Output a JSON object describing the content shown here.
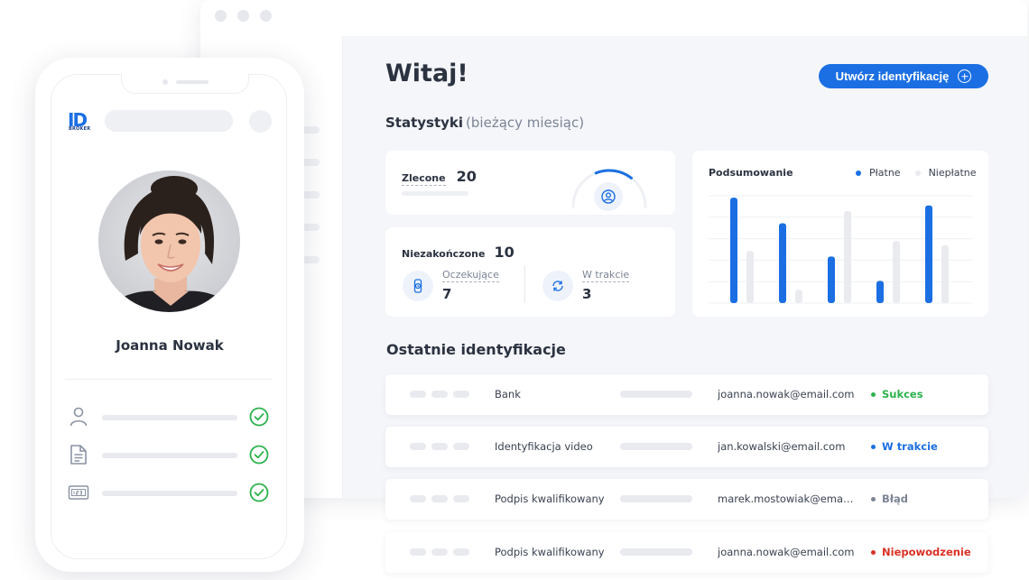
{
  "header": {
    "greeting": "Witaj!",
    "create_button_label": "Utwórz identyfikację"
  },
  "stats": {
    "title": "Statystyki",
    "subtitle": "(bieżący miesiąc)",
    "ordered": {
      "label": "Zlecone",
      "value": "20"
    },
    "unfinished": {
      "label": "Niezakończone",
      "value": "10"
    },
    "pending": {
      "label": "Oczekujące",
      "value": "7"
    },
    "in_progress": {
      "label": "W trakcie",
      "value": "3"
    },
    "gauge_fraction": 0.33
  },
  "chart_data": {
    "type": "bar",
    "title": "Podsumowanie",
    "legend_position": "top-right",
    "grid": true,
    "ylim": [
      0,
      1
    ],
    "categories": [
      "",
      "",
      "",
      "",
      ""
    ],
    "series": [
      {
        "name": "Płatne",
        "color": "#1b6fe3",
        "values": [
          0.95,
          0.72,
          0.42,
          0.2,
          0.88
        ]
      },
      {
        "name": "Niepłatne",
        "color": "#e9ebef",
        "values": [
          0.47,
          0.12,
          0.83,
          0.56,
          0.52
        ]
      }
    ]
  },
  "recent": {
    "title": "Ostatnie identyfikacje",
    "rows": [
      {
        "type": "Bank",
        "email": "joanna.nowak@email.com",
        "status": "Sukces",
        "status_color": "#2bb24c"
      },
      {
        "type": "Identyfikacja video",
        "email": "jan.kowalski@email.com",
        "status": "W trakcie",
        "status_color": "#1b6fe3"
      },
      {
        "type": "Podpis kwalifikowany",
        "email": "marek.mostowiak@email.com",
        "status": "Błąd",
        "status_color": "#7b8494"
      },
      {
        "type": "Podpis kwalifikowany",
        "email": "joanna.nowak@email.com",
        "status": "Niepowodzenie",
        "status_color": "#d93025"
      }
    ]
  },
  "phone": {
    "logo_text": "ID",
    "logo_subtext": "BROKER",
    "user_name": "Joanna Nowak",
    "checks": [
      {
        "icon": "user-icon",
        "done": true
      },
      {
        "icon": "document-icon",
        "done": true
      },
      {
        "icon": "id-number-icon",
        "done": true
      }
    ]
  },
  "colors": {
    "accent": "#1b6fe3",
    "success": "#2bb24c",
    "error": "#d93025"
  }
}
